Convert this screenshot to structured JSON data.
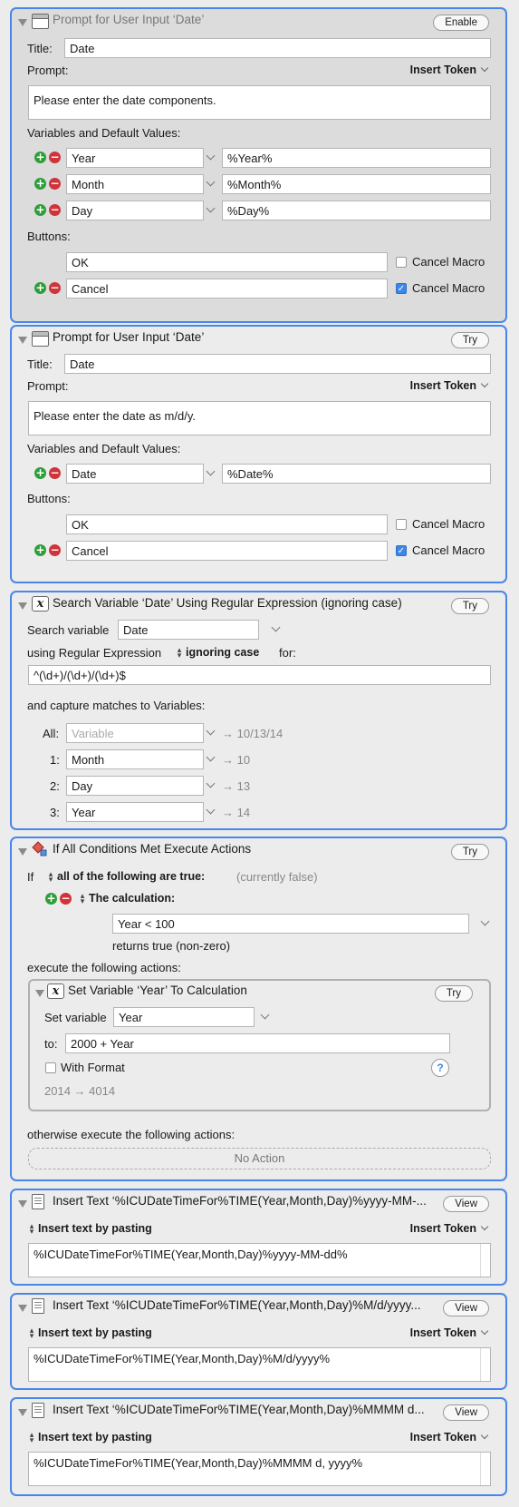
{
  "common": {
    "title_label": "Title:",
    "prompt_label": "Prompt:",
    "insert_token": "Insert Token",
    "variables_label": "Variables and Default Values:",
    "buttons_label": "Buttons:",
    "cancel_macro": "Cancel Macro"
  },
  "action1": {
    "title": "Prompt for User Input ‘Date’",
    "pill": "Enable",
    "title_value": "Date",
    "prompt_value": "Please enter the date components.",
    "variables": [
      {
        "name": "Year",
        "default": "%Year%"
      },
      {
        "name": "Month",
        "default": "%Month%"
      },
      {
        "name": "Day",
        "default": "%Day%"
      }
    ],
    "buttons": [
      {
        "name": "OK",
        "cancel_macro": false
      },
      {
        "name": "Cancel",
        "cancel_macro": true
      }
    ]
  },
  "action2": {
    "title": "Prompt for User Input ‘Date’",
    "pill": "Try",
    "title_value": "Date",
    "prompt_value": "Please enter the date as m/d/y.",
    "variables": [
      {
        "name": "Date",
        "default": "%Date%"
      }
    ],
    "buttons": [
      {
        "name": "OK",
        "cancel_macro": false
      },
      {
        "name": "Cancel",
        "cancel_macro": true
      }
    ]
  },
  "action3": {
    "title": "Search Variable ‘Date’ Using Regular Expression (ignoring case)",
    "pill": "Try",
    "search_variable_label": "Search variable",
    "search_variable": "Date",
    "using_label": "using Regular Expression",
    "mode": "ignoring case",
    "for_label": "for:",
    "regex": "^(\\d+)/(\\d+)/(\\d+)$",
    "capture_label": "and capture matches to Variables:",
    "captures": [
      {
        "label": "All:",
        "variable": "",
        "placeholder": "Variable",
        "result": "→ 10/13/14"
      },
      {
        "label": "1:",
        "variable": "Month",
        "placeholder": "",
        "result": "→ 10"
      },
      {
        "label": "2:",
        "variable": "Day",
        "placeholder": "",
        "result": "→ 13"
      },
      {
        "label": "3:",
        "variable": "Year",
        "placeholder": "",
        "result": "→ 14"
      }
    ]
  },
  "action4": {
    "title": "If All Conditions Met Execute Actions",
    "pill": "Try",
    "if_label": "If",
    "condition_mode": "all of the following are true:",
    "status": "(currently false)",
    "condition_type": "The calculation:",
    "calculation": "Year < 100",
    "returns": "returns true (non-zero)",
    "execute_label": "execute the following actions:",
    "nested": {
      "title": "Set Variable ‘Year’ To Calculation",
      "pill": "Try",
      "set_variable_label": "Set variable",
      "variable": "Year",
      "to_label": "to:",
      "to_value": "2000 + Year",
      "with_format": "With Format",
      "help": "?",
      "preview": "2014 → 4014"
    },
    "otherwise_label": "otherwise execute the following actions:",
    "no_action": "No Action"
  },
  "action5": {
    "title": "Insert Text ‘%ICUDateTimeFor%TIME(Year,Month,Day)%yyyy-MM-...",
    "pill": "View",
    "mode": "Insert text by pasting",
    "text": "%ICUDateTimeFor%TIME(Year,Month,Day)%yyyy-MM-dd%"
  },
  "action6": {
    "title": "Insert Text ‘%ICUDateTimeFor%TIME(Year,Month,Day)%M/d/yyyy...",
    "pill": "View",
    "mode": "Insert text by pasting",
    "text": "%ICUDateTimeFor%TIME(Year,Month,Day)%M/d/yyyy%"
  },
  "action7": {
    "title": "Insert Text ‘%ICUDateTimeFor%TIME(Year,Month,Day)%MMMM d...",
    "pill": "View",
    "mode": "Insert text by pasting",
    "text": "%ICUDateTimeFor%TIME(Year,Month,Day)%MMMM d, yyyy%"
  }
}
